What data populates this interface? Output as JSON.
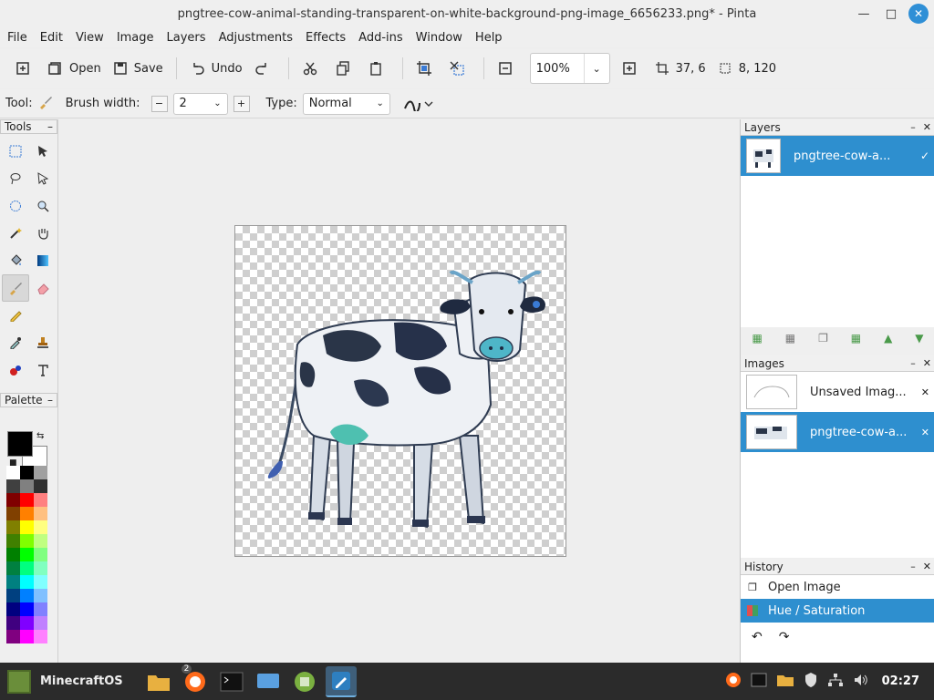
{
  "window": {
    "title": "pngtree-cow-animal-standing-transparent-on-white-background-png-image_6656233.png* - Pinta",
    "min_icon": "minimize-icon",
    "max_icon": "maximize-icon",
    "close_icon": "close-icon"
  },
  "menu": [
    "File",
    "Edit",
    "View",
    "Image",
    "Layers",
    "Adjustments",
    "Effects",
    "Add-ins",
    "Window",
    "Help"
  ],
  "toolbar": {
    "open_label": "Open",
    "save_label": "Save",
    "undo_label": "Undo",
    "zoom_value": "100%",
    "cursor_pos": "37, 6",
    "selection_size": "8, 120"
  },
  "options": {
    "tool_label": "Tool:",
    "brush_width_label": "Brush width:",
    "brush_width_value": "2",
    "type_label": "Type:",
    "type_value": "Normal"
  },
  "panels": {
    "tools_title": "Tools",
    "palette_title": "Palette",
    "layers_title": "Layers",
    "images_title": "Images",
    "history_title": "History"
  },
  "layers": [
    {
      "name": "pngtree-cow-a..."
    }
  ],
  "images": [
    {
      "name": "Unsaved Imag..."
    },
    {
      "name": "pngtree-cow-a..."
    }
  ],
  "history": [
    {
      "name": "Open Image"
    },
    {
      "name": "Hue / Saturation"
    }
  ],
  "palette": {
    "primary": "#000000",
    "secondary": "#ffffff",
    "swatches": [
      "#ffffff",
      "#000000",
      "#a0a0a0",
      "#404040",
      "#808080",
      "#303030",
      "#800000",
      "#ff0000",
      "#ff8080",
      "#804000",
      "#ff8000",
      "#ffc080",
      "#808000",
      "#ffff00",
      "#ffff80",
      "#408000",
      "#80ff00",
      "#c0ff80",
      "#008000",
      "#00ff00",
      "#80ff80",
      "#008040",
      "#00ff80",
      "#80ffc0",
      "#008080",
      "#00ffff",
      "#80ffff",
      "#004080",
      "#0080ff",
      "#80c0ff",
      "#000080",
      "#0000ff",
      "#8080ff",
      "#400080",
      "#8000ff",
      "#c080ff",
      "#800080",
      "#ff00ff",
      "#ff80ff"
    ]
  },
  "taskbar": {
    "start_label": "MinecraftOS",
    "badge": "2",
    "clock": "02:27"
  }
}
